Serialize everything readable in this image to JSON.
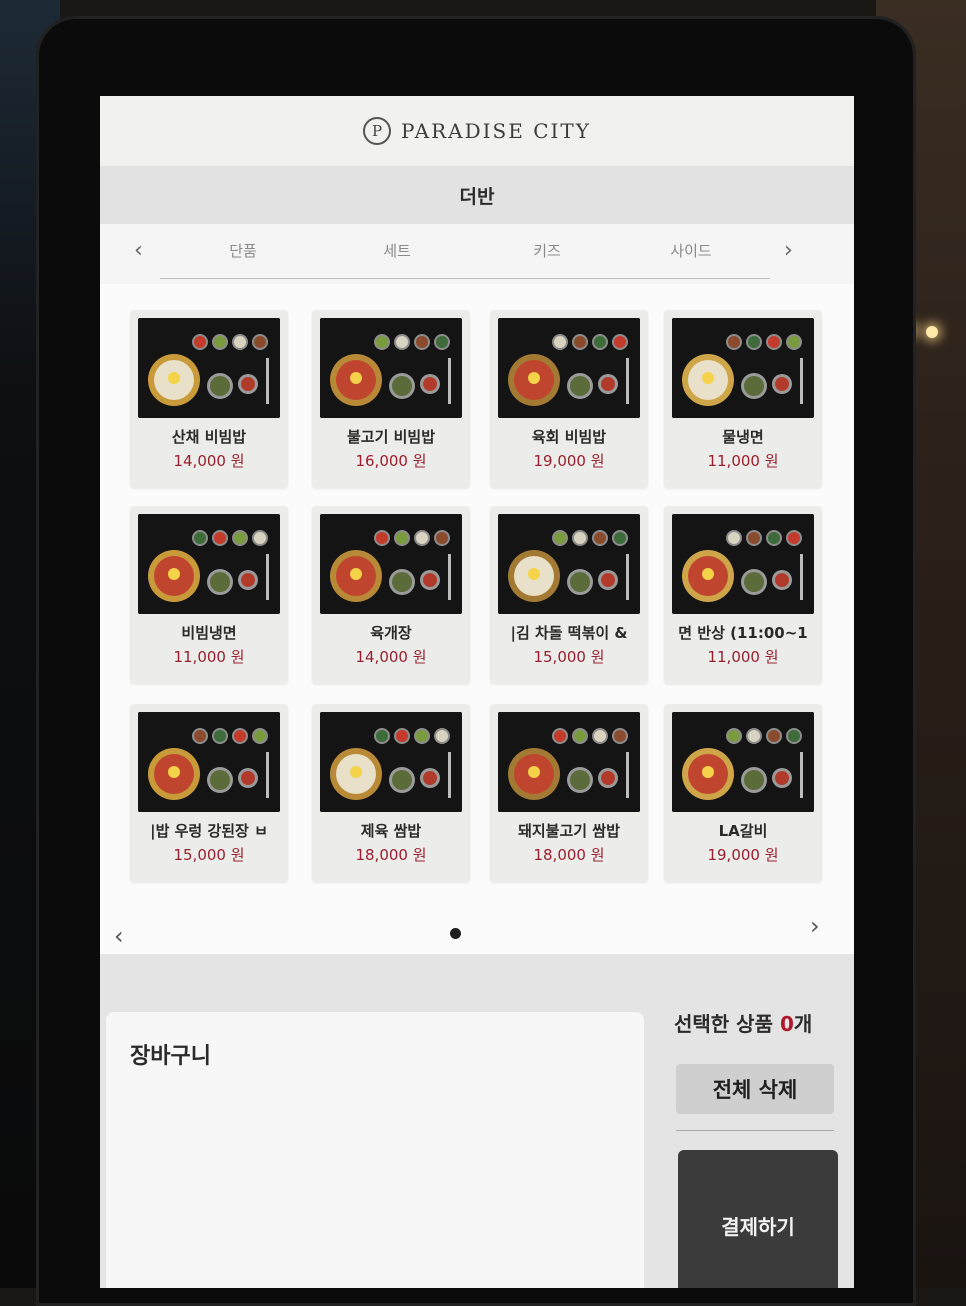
{
  "header": {
    "logo_mark": "P",
    "brand": "PARADISE CITY"
  },
  "store": {
    "name": "더반"
  },
  "tabs": [
    {
      "label": "단품",
      "active": true
    },
    {
      "label": "세트",
      "active": false
    },
    {
      "label": "키즈",
      "active": false
    },
    {
      "label": "사이드",
      "active": false
    }
  ],
  "menu": [
    {
      "name": "산채 비빔밥",
      "price": "14,000 원"
    },
    {
      "name": "불고기 비빔밥",
      "price": "16,000 원"
    },
    {
      "name": "육회 비빔밥",
      "price": "19,000 원"
    },
    {
      "name": "물냉면",
      "price": "11,000 원"
    },
    {
      "name": "비빔냉면",
      "price": "11,000 원"
    },
    {
      "name": "육개장",
      "price": "14,000 원"
    },
    {
      "name": "|김    차돌 떡볶이 &",
      "price": "15,000 원"
    },
    {
      "name": "면 반상    (11:00~1",
      "price": "11,000 원"
    },
    {
      "name": "|밥    우렁 강된장 ㅂ",
      "price": "15,000 원"
    },
    {
      "name": "제육 쌈밥",
      "price": "18,000 원"
    },
    {
      "name": "돼지불고기 쌈밥",
      "price": "18,000 원"
    },
    {
      "name": "LA갈비",
      "price": "19,000 원"
    }
  ],
  "cart": {
    "title": "장바구니",
    "selected_label": "선택한 상품",
    "selected_count": "0",
    "selected_unit": "개",
    "clear_label": "전체 삭제",
    "pay_label": "결제하기"
  },
  "colors": {
    "price": "#9a1f2e",
    "count": "#b0182a",
    "pay_button": "#3b3b3b"
  }
}
